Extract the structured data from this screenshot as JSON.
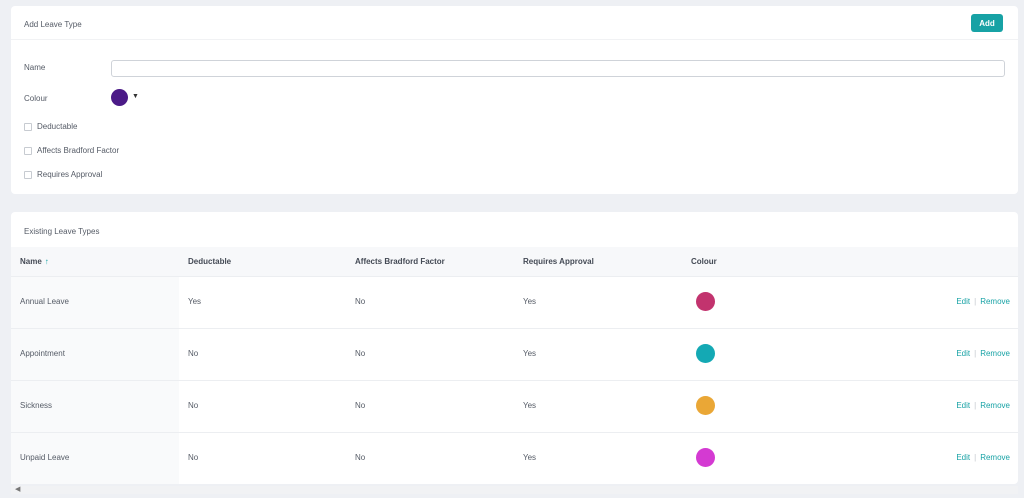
{
  "add_form": {
    "title": "Add Leave Type",
    "add_label": "Add",
    "name_label": "Name",
    "name_value": "",
    "colour_label": "Colour",
    "colour_value": "#4b1a87",
    "checkboxes": [
      {
        "label": "Deductable",
        "checked": false
      },
      {
        "label": "Affects Bradford Factor",
        "checked": false
      },
      {
        "label": "Requires Approval",
        "checked": false
      }
    ]
  },
  "list": {
    "title": "Existing Leave Types",
    "columns": [
      "Name",
      "Deductable",
      "Affects Bradford Factor",
      "Requires Approval",
      "Colour"
    ],
    "sort_icon": "sort-ascending-icon",
    "edit_label": "Edit",
    "separator": "|",
    "remove_label": "Remove",
    "rows": [
      {
        "name": "Annual Leave",
        "deductable": "Yes",
        "bradford": "No",
        "approval": "Yes",
        "colour": "#c2336e"
      },
      {
        "name": "Appointment",
        "deductable": "No",
        "bradford": "No",
        "approval": "Yes",
        "colour": "#14a9b4"
      },
      {
        "name": "Sickness",
        "deductable": "No",
        "bradford": "No",
        "approval": "Yes",
        "colour": "#eaa736"
      },
      {
        "name": "Unpaid Leave",
        "deductable": "No",
        "bradford": "No",
        "approval": "Yes",
        "colour": "#d43ad2"
      }
    ]
  },
  "accent_color": "#17a2a5"
}
